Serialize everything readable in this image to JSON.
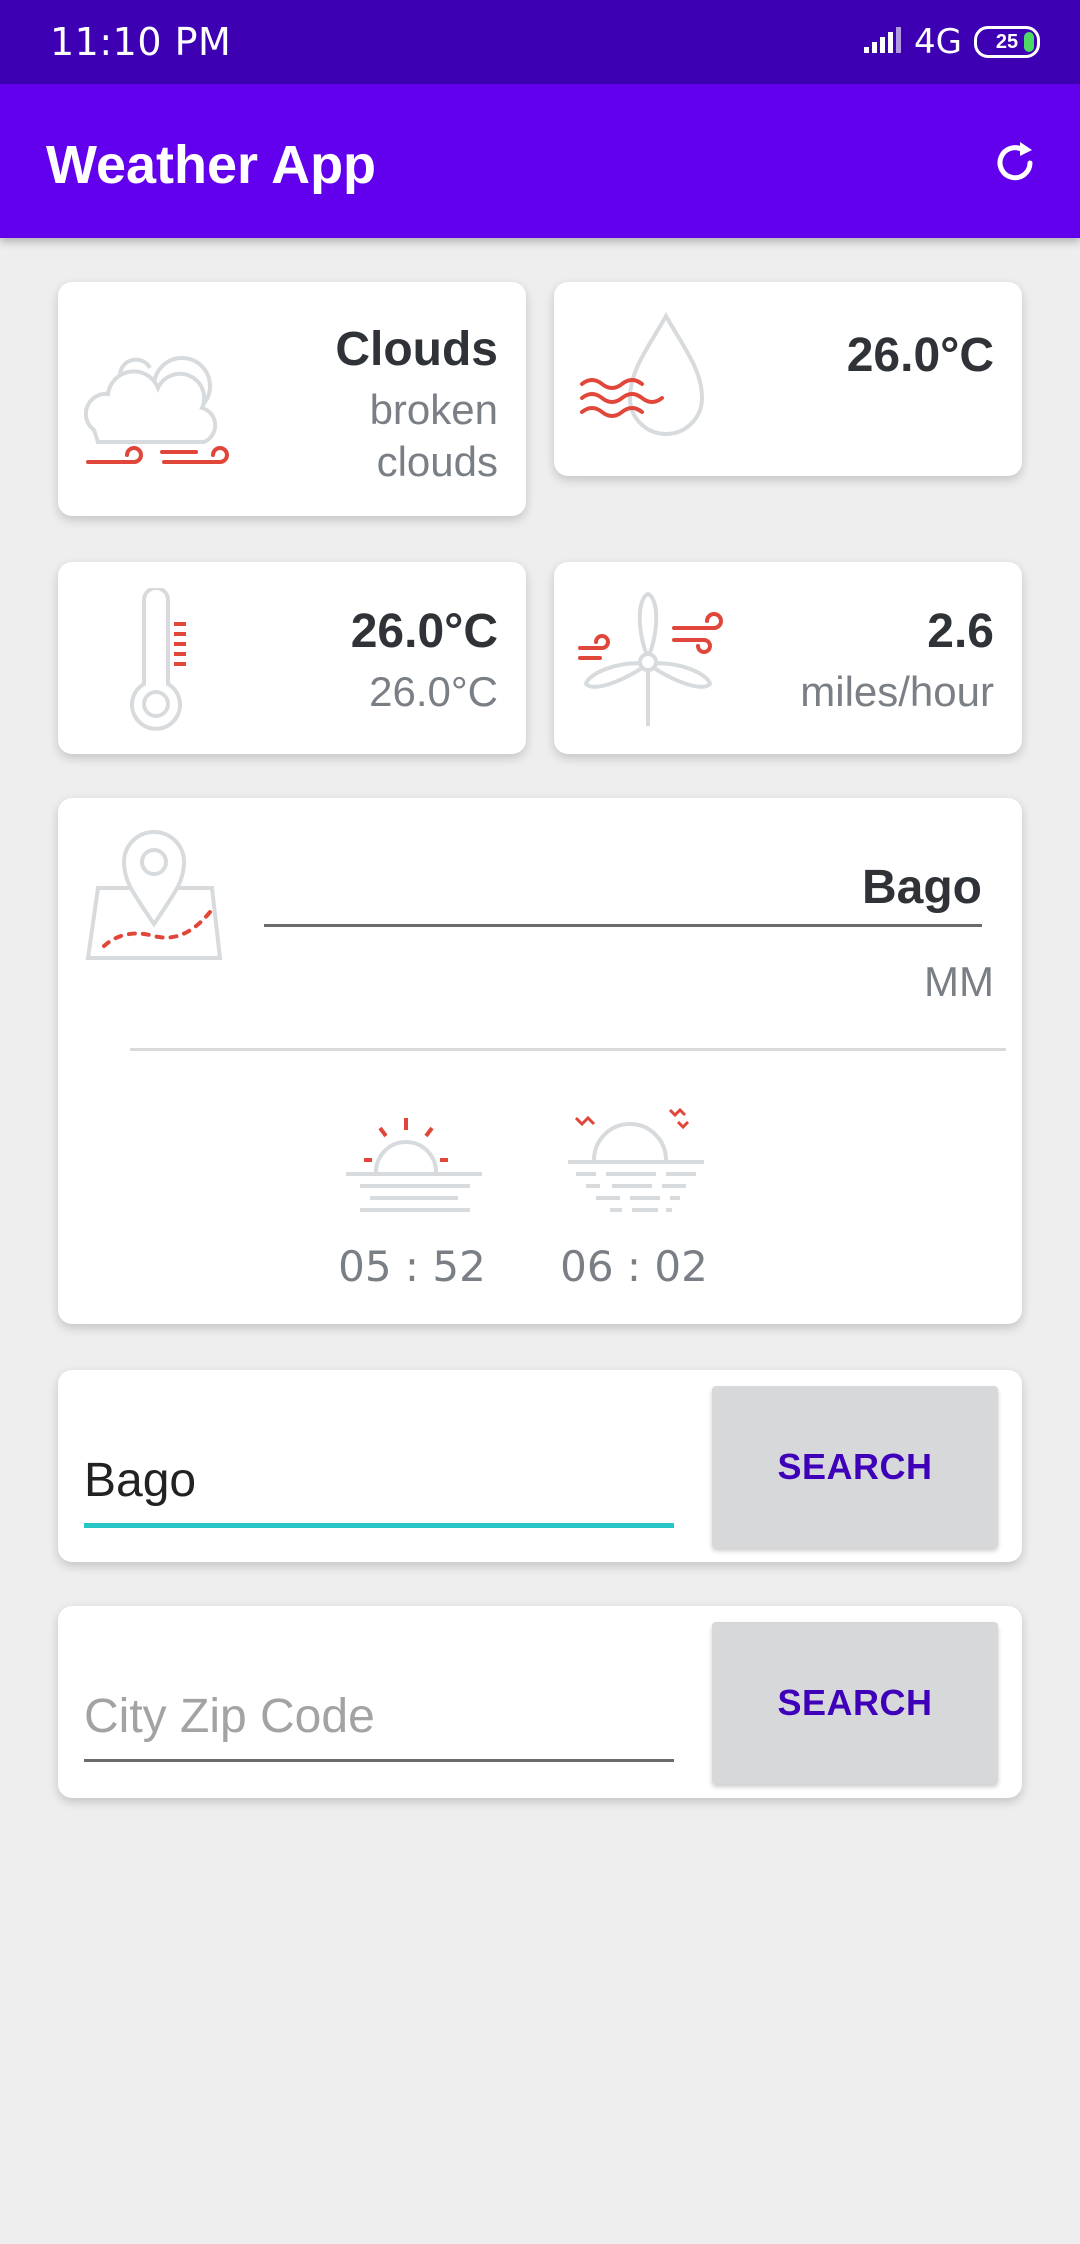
{
  "status_bar": {
    "time": "11:10 PM",
    "network": "4G",
    "battery": "25"
  },
  "app_bar": {
    "title": "Weather App"
  },
  "weather": {
    "condition_main": "Clouds",
    "condition_desc_line1": "broken",
    "condition_desc_line2": "clouds",
    "humidity_value": "26.0°C",
    "temp_main": "26.0°C",
    "temp_sub": "26.0°C",
    "wind_speed": "2.6",
    "wind_unit": "miles/hour"
  },
  "location": {
    "city": "Bago",
    "country": "MM",
    "sunrise": "05 : 52",
    "sunset": "06 : 02"
  },
  "search_city": {
    "value": "Bago",
    "button_label": "SEARCH"
  },
  "search_zip": {
    "value": "",
    "placeholder": "City Zip Code",
    "button_label": "SEARCH"
  },
  "colors": {
    "status_bar": "#3d00b3",
    "app_bar": "#6200ee",
    "accent_red": "#e0473a",
    "button_text": "#3e00b9",
    "input_active_underline": "#26c6c6"
  }
}
